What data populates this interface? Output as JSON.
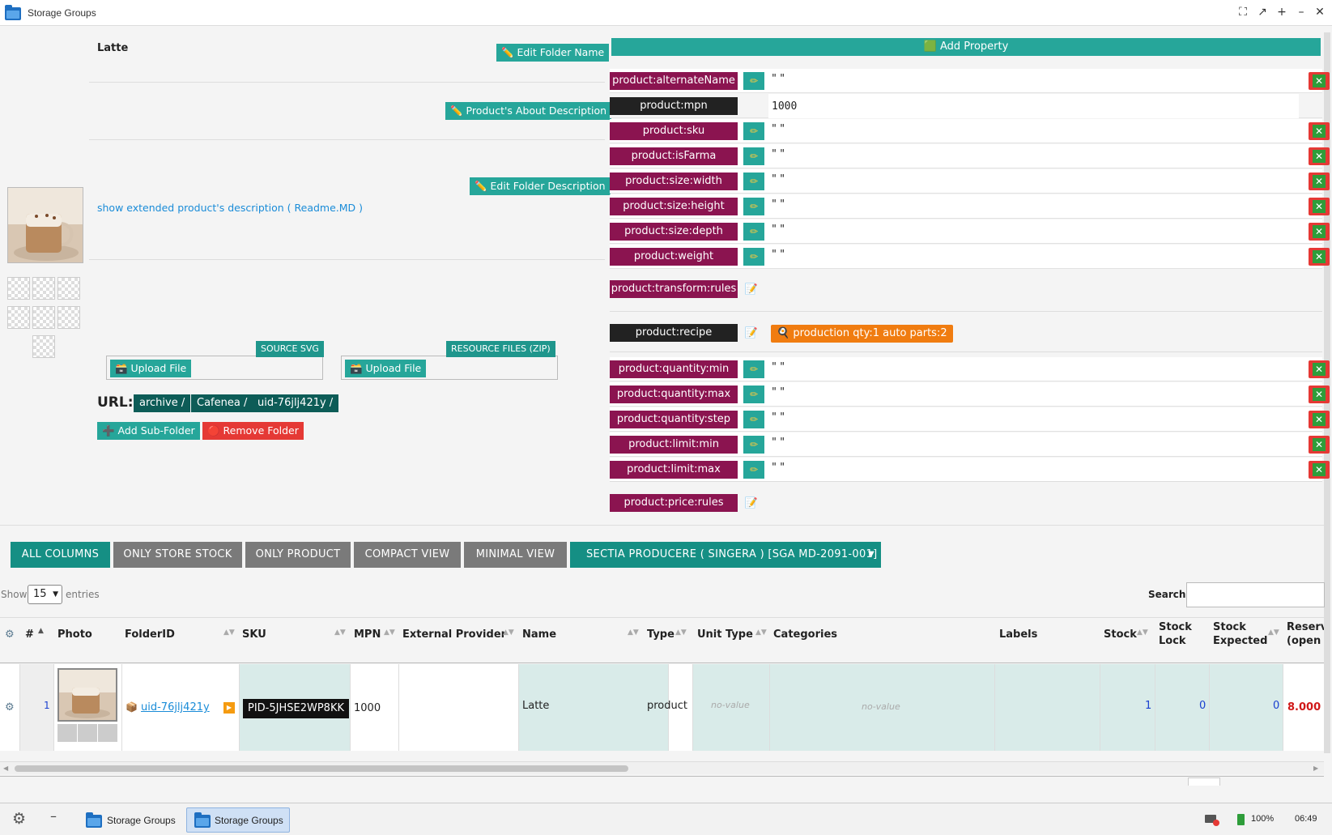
{
  "window": {
    "title": "Storage Groups"
  },
  "folder": {
    "name": "Latte",
    "edit_name_label": "✏️ Edit Folder Name",
    "about_label": "✏️ Product's About Description",
    "edit_desc_label": "✏️ Edit Folder Description",
    "extended_link": "show extended product's description ( Readme.MD )",
    "source_svg": "SOURCE SVG",
    "resource_files": "RESOURCE FILES (ZIP)",
    "upload_label": "🗃️ Upload File",
    "url_label": "URL:",
    "url_parts": [
      "archive /",
      "Cafenea /",
      "uid-76jlj421y /"
    ],
    "add_subfolder": "➕ Add Sub-Folder",
    "remove_folder": "🔴 Remove Folder"
  },
  "properties": {
    "add_label": "🟩 Add Property",
    "rows": [
      {
        "key": "product:alternateName",
        "value": "\" \""
      },
      {
        "key": "product:mpn",
        "value": "1000"
      },
      {
        "key": "product:sku",
        "value": "\" \""
      },
      {
        "key": "product:isFarma",
        "value": "\" \""
      },
      {
        "key": "product:size:width",
        "value": "\" \""
      },
      {
        "key": "product:size:height",
        "value": "\" \""
      },
      {
        "key": "product:size:depth",
        "value": "\" \""
      },
      {
        "key": "product:weight",
        "value": "\" \""
      }
    ],
    "transform_rules": "product:transform:rules",
    "recipe": "product:recipe",
    "recipe_badge": "🍳 production qty:1 auto parts:2",
    "rows2": [
      {
        "key": "product:quantity:min",
        "value": "\" \""
      },
      {
        "key": "product:quantity:max",
        "value": "\" \""
      },
      {
        "key": "product:quantity:step",
        "value": "\" \""
      },
      {
        "key": "product:limit:min",
        "value": "\" \""
      },
      {
        "key": "product:limit:max",
        "value": "\" \""
      }
    ],
    "price_rules": "product:price:rules"
  },
  "toolbar": {
    "all_columns": "ALL COLUMNS",
    "only_store_stock": "ONLY STORE STOCK",
    "only_product": "ONLY PRODUCT",
    "compact_view": "COMPACT VIEW",
    "minimal_view": "MINIMAL VIEW",
    "section_select": "SECTIA PRODUCERE ( SINGERA ) [SGA MD-2091-001]"
  },
  "table": {
    "show": "Show",
    "entries_value": "15",
    "entries": "entries",
    "search_label": "Search:",
    "headers": {
      "num": "#",
      "photo": "Photo",
      "folder_id": "FolderID",
      "sku": "SKU",
      "mpn": "MPN",
      "external_provider": "External Provider",
      "name": "Name",
      "type": "Type",
      "unit_type": "Unit Type",
      "categories": "Categories",
      "labels": "Labels",
      "stock": "Stock",
      "stock_lock_1": "Stock",
      "stock_lock_2": "Lock",
      "stock_expected_1": "Stock",
      "stock_expected_2": "Expected",
      "reserved_1": "Reserv",
      "reserved_2": "(open o"
    },
    "row": {
      "num": "1",
      "folder_id": "uid-76jlj421y",
      "sku": "PID-5JHSE2WP8KK",
      "mpn": "1000",
      "name": "Latte",
      "type": "product",
      "unit_type": "no-value",
      "categories": "no-value",
      "stock": "1",
      "stock_lock": "0",
      "stock_expected": "0",
      "reserved": "8.000"
    }
  },
  "taskbar": {
    "items": [
      "Storage Groups",
      "Storage Groups"
    ],
    "battery": "100%",
    "clock": "06:49"
  }
}
